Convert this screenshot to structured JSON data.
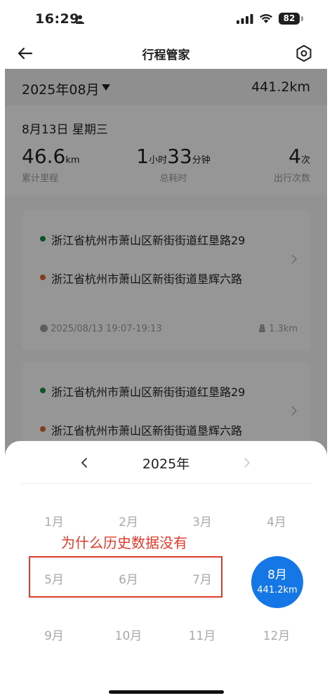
{
  "status_bar": {
    "time": "16:29",
    "battery": "82"
  },
  "nav": {
    "title": "行程管家",
    "back_icon": "arrow-left-icon",
    "settings_icon": "gear-icon"
  },
  "month_bar": {
    "month": "2025年08月",
    "total_distance": "441.2km"
  },
  "day_summary": {
    "date": "8月13日 星期三",
    "distance": {
      "value": "46.6",
      "unit": "km",
      "label": "累计里程"
    },
    "duration": {
      "h_value": "1",
      "h_unit": "小时",
      "m_value": "33",
      "m_unit": "分钟",
      "label": "总耗时"
    },
    "trips": {
      "value": "4",
      "unit": "次",
      "label": "出行次数"
    }
  },
  "trips": [
    {
      "from": "浙江省杭州市萧山区新街街道红垦路29",
      "to": "浙江省杭州市萧山区新街街道垦辉六路",
      "time": "2025/08/13 19:07-19:13",
      "distance": "1.3km"
    },
    {
      "from": "浙江省杭州市萧山区新街街道红垦路29",
      "to": "浙江省杭州市萧山区新街街道垦辉六路"
    }
  ],
  "month_picker": {
    "year": "2025年",
    "months": [
      "1月",
      "2月",
      "3月",
      "4月",
      "5月",
      "6月",
      "7月",
      "8月",
      "9月",
      "10月",
      "11月",
      "12月"
    ],
    "selected_month": "8月",
    "selected_distance": "441.2km"
  },
  "annotation": {
    "text": "为什么历史数据没有"
  },
  "colors": {
    "accent": "#1577e6",
    "annotation": "#e23b2c",
    "start_dot": "#1f8a3a",
    "end_dot": "#d9642a"
  }
}
